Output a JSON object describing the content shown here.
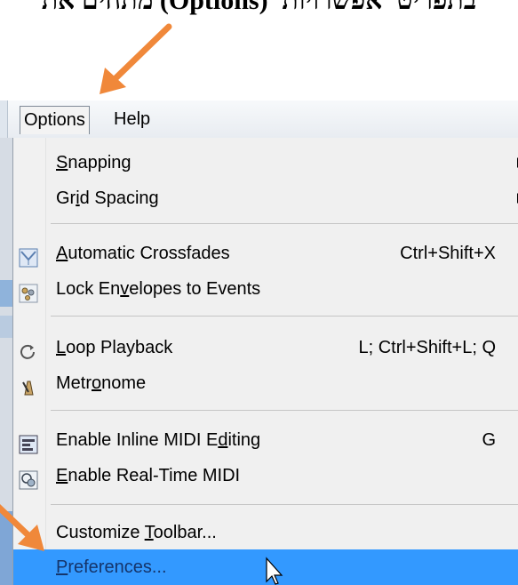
{
  "caption": "בתפריט 'אפשרויות' (Options) מתחים את",
  "menubar": {
    "options": "Options",
    "help": "Help"
  },
  "menu": {
    "items": [
      {
        "pre": "",
        "ul": "S",
        "post": "napping",
        "submenu": true
      },
      {
        "pre": "Gr",
        "ul": "i",
        "post": "d Spacing",
        "submenu": true
      },
      {
        "pre": "",
        "ul": "A",
        "post": "utomatic Crossfades",
        "shortcut": "Ctrl+Shift+X",
        "icon": "crossfade-icon"
      },
      {
        "pre": "Lock En",
        "ul": "v",
        "post": "elopes to Events",
        "icon": "lock-envelopes-icon"
      },
      {
        "pre": "",
        "ul": "L",
        "post": "oop Playback",
        "shortcut": "L; Ctrl+Shift+L; Q",
        "icon": "loop-icon"
      },
      {
        "pre": "Metr",
        "ul": "o",
        "post": "nome",
        "icon": "metronome-icon"
      },
      {
        "pre": "Enable Inline MIDI E",
        "ul": "d",
        "post": "iting",
        "shortcut": "G",
        "icon": "inline-midi-icon"
      },
      {
        "pre": "",
        "ul": "E",
        "post": "nable Real-Time MIDI",
        "icon": "realtime-midi-icon"
      },
      {
        "pre": "Customize ",
        "ul": "T",
        "post": "oolbar...",
        "icon": ""
      },
      {
        "pre": "",
        "ul": "P",
        "post": "references...",
        "icon": "",
        "highlighted": true
      }
    ]
  },
  "colors": {
    "highlight": "#3399ff",
    "arrow": "#f0883a"
  }
}
